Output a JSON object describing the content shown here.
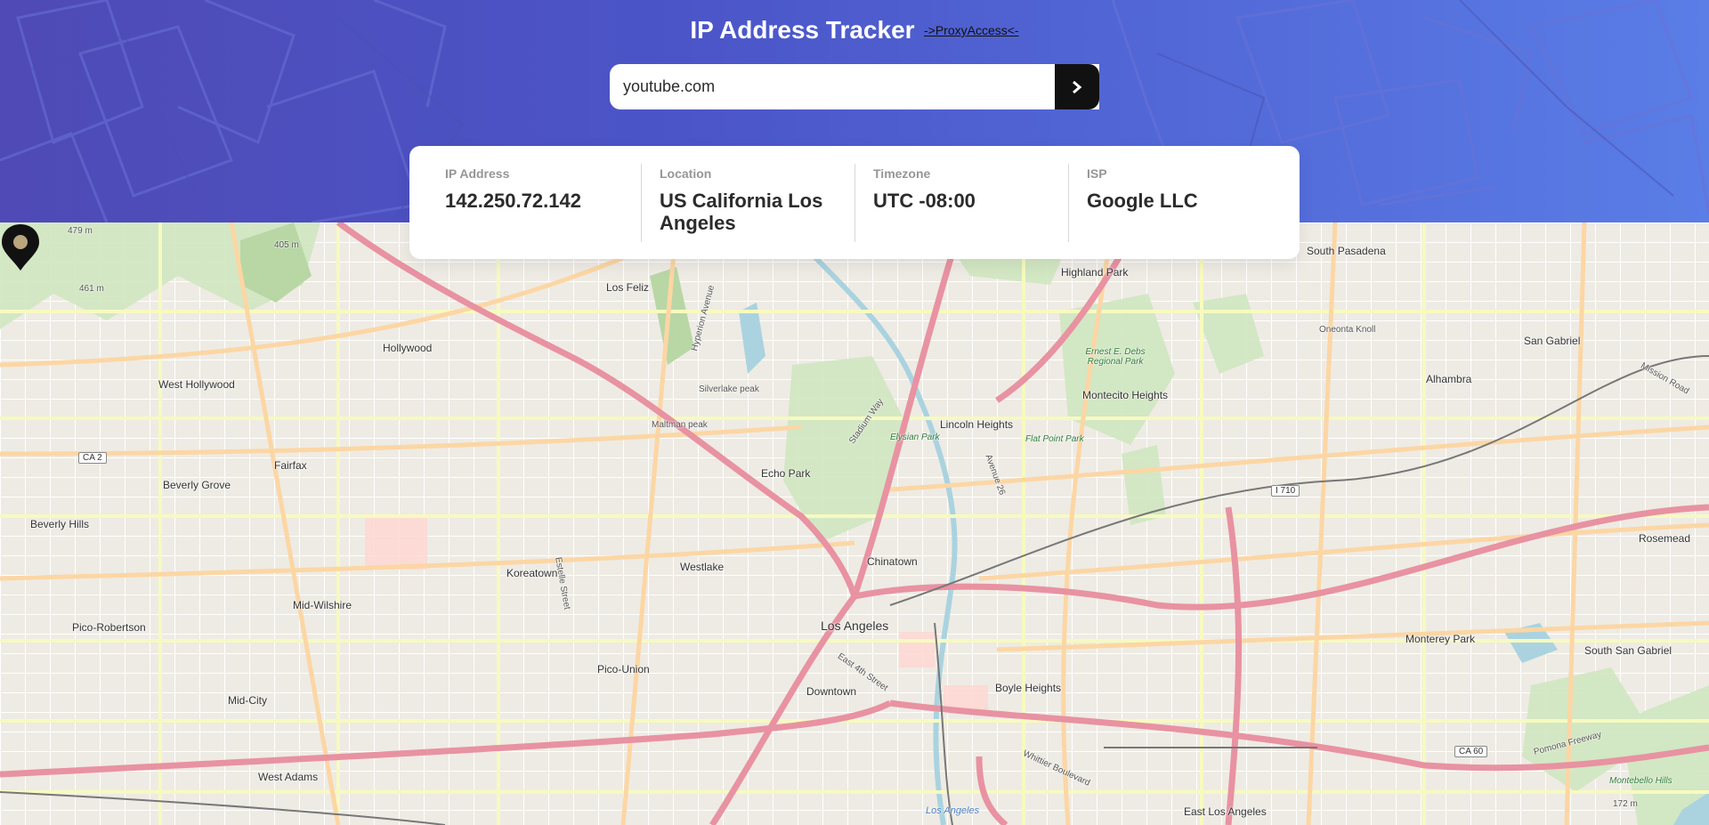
{
  "header": {
    "title": "IP Address Tracker",
    "proxy_link": "->ProxyAccess<-",
    "search_value": "youtube.com",
    "submit_icon": "chevron-right-icon"
  },
  "info": {
    "ip_label": "IP Address",
    "ip_value": "142.250.72.142",
    "location_label": "Location",
    "location_value": "US California Los Angeles",
    "timezone_label": "Timezone",
    "timezone_value": "UTC -08:00",
    "isp_label": "ISP",
    "isp_value": "Google LLC"
  },
  "map": {
    "places": {
      "south_pasadena": "South Pasadena",
      "highland_park": "Highland Park",
      "los_feliz": "Los Feliz",
      "hollywood": "Hollywood",
      "west_hollywood": "West Hollywood",
      "san_gabriel": "San Gabriel",
      "alhambra": "Alhambra",
      "lincoln_heights": "Lincoln Heights",
      "montecito_heights": "Montecito Heights",
      "fairfax": "Fairfax",
      "beverly_grove": "Beverly Grove",
      "beverly_hills": "Beverly Hills",
      "echo_park": "Echo Park",
      "chinatown": "Chinatown",
      "koreatown": "Koreatown",
      "westlake": "Westlake",
      "mid_wilshire": "Mid-Wilshire",
      "pico_robertson": "Pico-Robertson",
      "pico_union": "Pico-Union",
      "los_angeles": "Los Angeles",
      "downtown": "Downtown",
      "boyle_heights": "Boyle Heights",
      "monterey_park": "Monterey Park",
      "south_san_gabriel": "South San Gabriel",
      "rosemead": "Rosemead",
      "mid_city": "Mid-City",
      "west_adams": "West Adams",
      "east_los_angeles": "East Los Angeles",
      "silverlake_peak": "Silverlake peak",
      "maltman_peak": "Maltman peak",
      "oneonta_knoll": "Oneonta Knoll",
      "flat_point_park": "Flat Point Park",
      "elysian_park": "Elysian Park",
      "ernest_debs": "Ernest E. Debs Regional Park",
      "montebello_hills": "Montebello Hills",
      "los_angeles_river": "Los Angeles",
      "elev_479": "479 m",
      "elev_461": "461 m",
      "elev_405": "405 m",
      "elev_172": "172 m",
      "mission_road": "Mission Road",
      "pomona_freeway": "Pomona Freeway",
      "whittier_blvd": "Whittier Boulevard",
      "stadium_way": "Stadium Way",
      "avenue_26": "Avenue 26",
      "hyperion_avenue": "Hyperion Avenue",
      "east_4th_street": "East 4th Street",
      "estelle_street": "Estelle Street"
    },
    "shields": {
      "ca2": "CA 2",
      "i710": "I 710",
      "ca60": "CA 60"
    },
    "marker_icon": "location-pin-icon"
  },
  "colors": {
    "header_start": "#4f4ab5",
    "header_end": "#5a7de6",
    "button": "#111111",
    "freeway": "#e892a2",
    "primary_road": "#fcd6a4",
    "park": "#c8facc"
  }
}
